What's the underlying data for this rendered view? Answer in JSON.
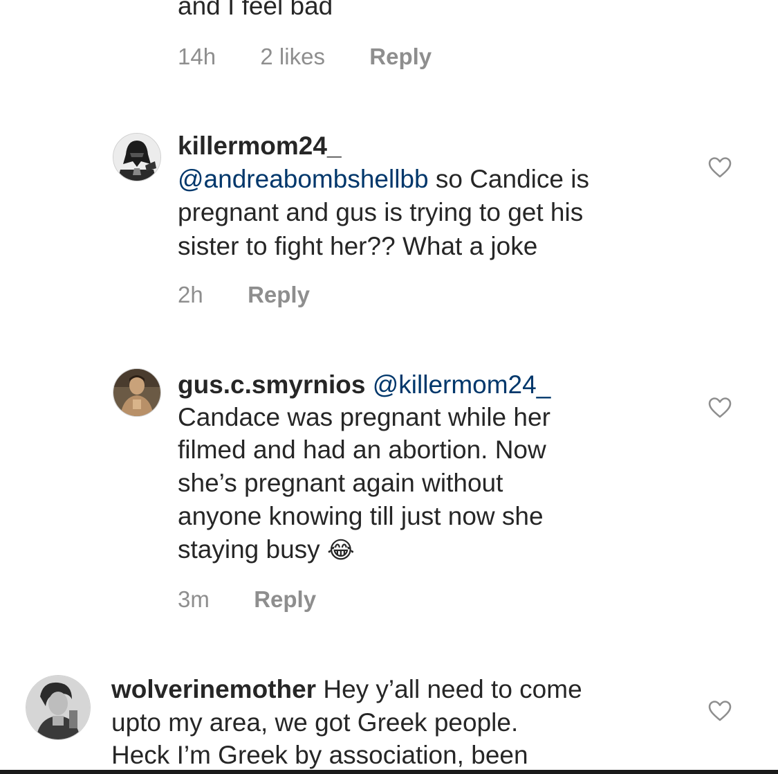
{
  "top_fragment": {
    "text": "and I feel bad",
    "time": "14h",
    "likes": "2 likes",
    "reply": "Reply"
  },
  "comments": [
    {
      "username": "killermom24_",
      "lines": [
        {
          "mention": "@andreabombshellbb",
          "text": " so Candice is"
        },
        {
          "text": "pregnant and gus is trying to get his"
        },
        {
          "text": "sister to fight her?? What a joke"
        }
      ],
      "time": "2h",
      "reply": "Reply",
      "avatar": "darth-vader-avatar"
    },
    {
      "username": "gus.c.smyrnios",
      "mention": "@killermom24_",
      "lines": [
        {
          "text": "Candace was pregnant while her"
        },
        {
          "text": "filmed and had an abortion. Now"
        },
        {
          "text": "she’s pregnant again without"
        },
        {
          "text": "anyone knowing till just now she"
        },
        {
          "text": "staying busy"
        }
      ],
      "emoji": "😂",
      "time": "3m",
      "reply": "Reply",
      "avatar": "person-photo-avatar"
    },
    {
      "username": "wolverinemother",
      "lines": [
        {
          "text": " Hey y’all need to come"
        },
        {
          "text": "upto my area, we got Greek people."
        },
        {
          "text": "Heck I’m Greek by association, been"
        }
      ],
      "avatar": "woman-bw-photo-avatar"
    }
  ],
  "colors": {
    "text": "#262626",
    "meta": "#8e8e8e",
    "mention": "#00376b",
    "heart_stroke": "#8e8e8e"
  }
}
